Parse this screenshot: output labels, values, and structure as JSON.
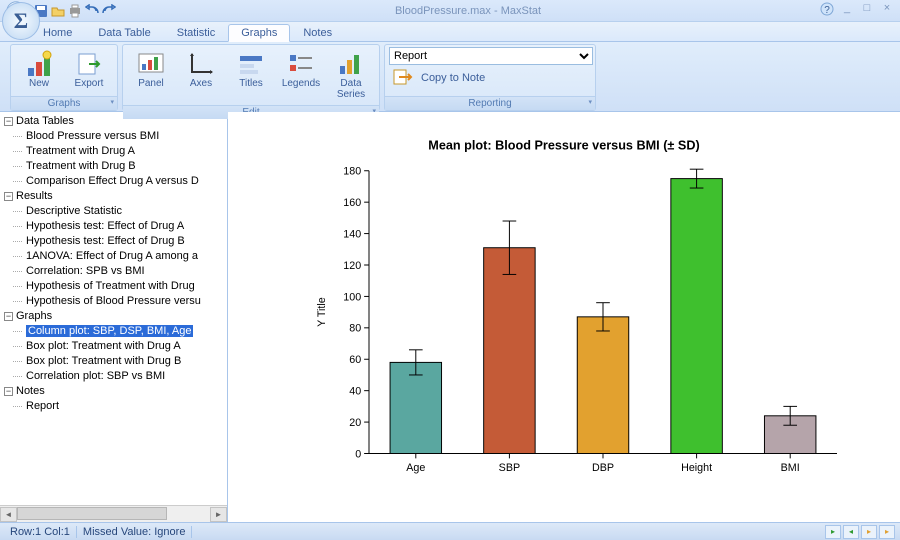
{
  "window_title": "BloodPressure.max - MaxStat",
  "menu_tabs": [
    "Home",
    "Data Table",
    "Statistic",
    "Graphs",
    "Notes"
  ],
  "active_tab": "Graphs",
  "ribbon": {
    "groups": [
      {
        "label": "Graphs",
        "items": [
          {
            "name": "new",
            "label": "New"
          },
          {
            "name": "export",
            "label": "Export"
          }
        ]
      },
      {
        "label": "Edit",
        "items": [
          {
            "name": "panel",
            "label": "Panel"
          },
          {
            "name": "axes",
            "label": "Axes"
          },
          {
            "name": "titles",
            "label": "Titles"
          },
          {
            "name": "legends",
            "label": "Legends"
          },
          {
            "name": "data-series",
            "label": "Data\nSeries"
          }
        ]
      },
      {
        "label": "Reporting",
        "report_select": "Report",
        "copy_label": "Copy to Note"
      }
    ]
  },
  "tree": {
    "data_tables_label": "Data Tables",
    "data_tables": [
      "Blood Pressure versus BMI",
      "Treatment with Drug A",
      "Treatment with Drug B",
      "Comparison Effect Drug A versus D"
    ],
    "results_label": "Results",
    "results": [
      "Descriptive Statistic",
      "Hypothesis test: Effect of Drug A",
      "Hypothesis test: Effect of Drug B",
      "1ANOVA: Effect of Drug A among a",
      "Correlation: SPB vs BMI",
      "Hypothesis of Treatment with Drug",
      "Hypothesis of Blood Pressure versu"
    ],
    "graphs_label": "Graphs",
    "graphs": [
      "Column plot: SBP, DSP, BMI, Age",
      "Box plot: Treatment with Drug A",
      "Box plot: Treatment with Drug B",
      "Correlation plot: SBP vs BMI"
    ],
    "graphs_selected_index": 0,
    "notes_label": "Notes",
    "notes": [
      "Report"
    ]
  },
  "status": {
    "row_col": "Row:1 Col:1",
    "missed": "Missed Value: Ignore"
  },
  "chart_data": {
    "type": "bar",
    "title": "Mean plot: Blood Pressure versus BMI (± SD)",
    "xlabel": "",
    "ylabel": "Y Title",
    "ylim": [
      0,
      180
    ],
    "yticks": [
      0,
      20,
      40,
      60,
      80,
      100,
      120,
      140,
      160,
      180
    ],
    "categories": [
      "Age",
      "SBP",
      "DBP",
      "Height",
      "BMI"
    ],
    "values": [
      58,
      131,
      87,
      175,
      24
    ],
    "errors": [
      8,
      17,
      9,
      6,
      6
    ],
    "colors": [
      "#5aa7a0",
      "#c45b37",
      "#e2a12f",
      "#3fc02e",
      "#b5a4aa"
    ]
  }
}
